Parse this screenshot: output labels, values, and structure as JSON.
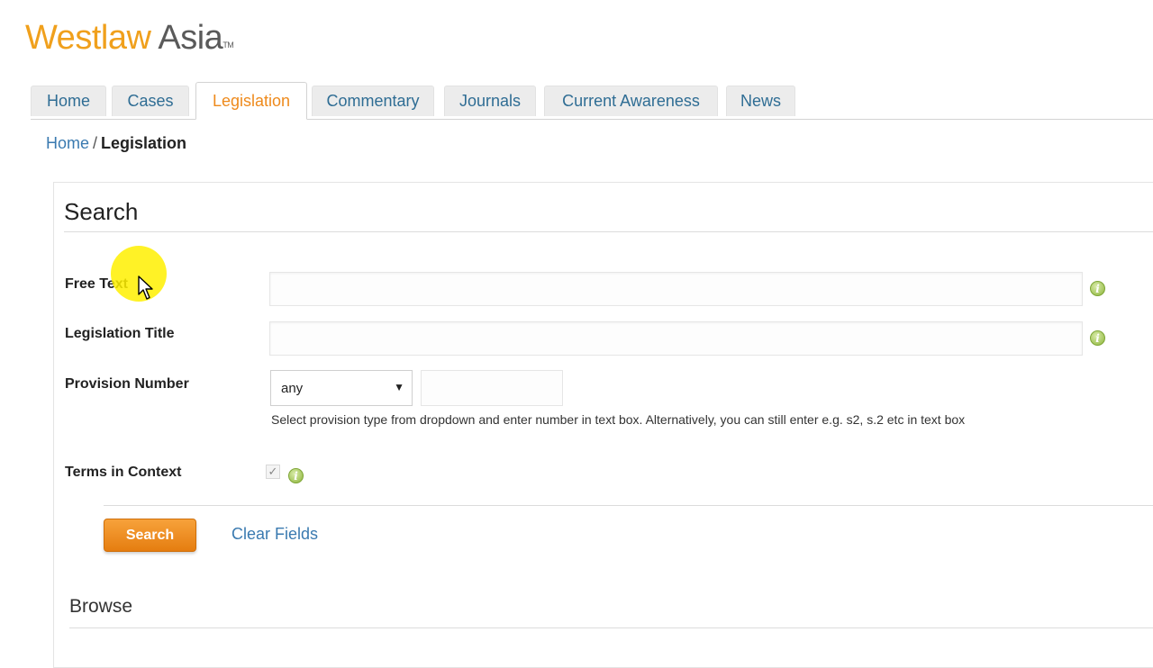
{
  "brand": {
    "name_part1": "Westlaw",
    "name_part2": "Asia",
    "trademark": "TM"
  },
  "tabs": [
    {
      "label": "Home",
      "active": false
    },
    {
      "label": "Cases",
      "active": false
    },
    {
      "label": "Legislation",
      "active": true
    },
    {
      "label": "Commentary",
      "active": false
    },
    {
      "label": "Journals",
      "active": false
    },
    {
      "label": "Current Awareness",
      "active": false
    },
    {
      "label": "News",
      "active": false
    }
  ],
  "breadcrumb": {
    "home": "Home",
    "separator": "/",
    "current": "Legislation"
  },
  "search": {
    "title": "Search",
    "free_text_label": "Free Text",
    "free_text_value": "",
    "legislation_title_label": "Legislation Title",
    "legislation_title_value": "",
    "provision_number_label": "Provision Number",
    "provision_type_selected": "any",
    "provision_number_value": "",
    "provision_hint": "Select provision type from dropdown and enter number in text box. Alternatively, you can still enter e.g. s2, s.2 etc in text box",
    "terms_in_context_label": "Terms in Context",
    "terms_in_context_checked": true,
    "search_button": "Search",
    "clear_fields": "Clear Fields",
    "info_icon_glyph": "i"
  },
  "browse": {
    "title": "Browse"
  },
  "colors": {
    "accent": "#ee8a1c",
    "link": "#3a7ab0",
    "info_green": "#8db43a"
  }
}
